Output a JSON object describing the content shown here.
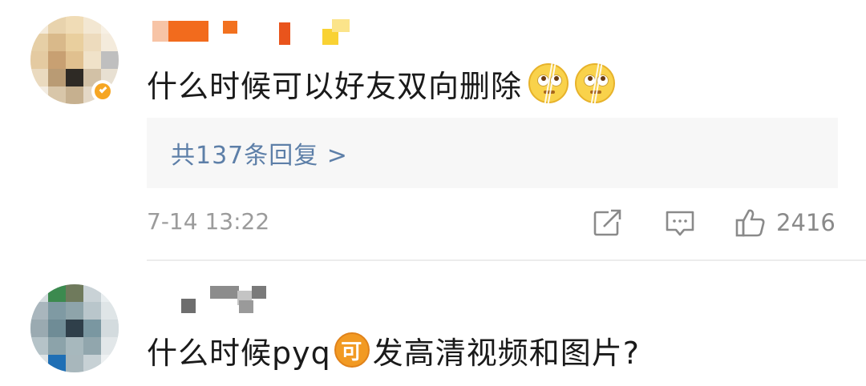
{
  "comments": [
    {
      "username": "",
      "text": "什么时候可以好友双向删除",
      "emojis": [
        "eye-roll-emoji",
        "eye-roll-emoji"
      ],
      "replies_label": "共137条回复 >",
      "timestamp": "7-14 13:22",
      "like_count": "2416",
      "verified": true
    },
    {
      "username": "",
      "text_before": "什么时候pyq",
      "badge": "可",
      "text_after": "发高清视频和图片?"
    }
  ],
  "colors": {
    "link": "#5d7fa8",
    "meta": "#9b9b9b",
    "verified_badge": "#f6a623",
    "ke_badge": "#f29a23"
  }
}
